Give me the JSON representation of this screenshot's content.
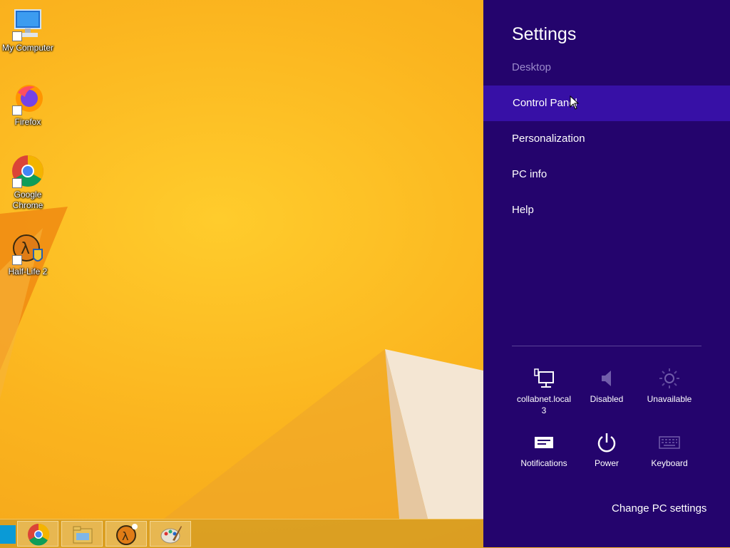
{
  "desktop": {
    "icons": [
      {
        "label": "My Computer",
        "icon": "computer-icon"
      },
      {
        "label": "Firefox",
        "icon": "firefox-icon"
      },
      {
        "label": "Google Chrome",
        "icon": "chrome-icon"
      },
      {
        "label": "Half-Life 2",
        "icon": "half-life-2-icon"
      }
    ]
  },
  "taskbar": {
    "buttons": [
      {
        "icon": "chrome-icon"
      },
      {
        "icon": "file-explorer-icon"
      },
      {
        "icon": "half-life-2-icon"
      },
      {
        "icon": "paint-icon"
      }
    ]
  },
  "settings": {
    "title": "Settings",
    "context": "Desktop",
    "items": [
      {
        "label": "Control Panel",
        "active": true
      },
      {
        "label": "Personalization",
        "active": false
      },
      {
        "label": "PC info",
        "active": false
      },
      {
        "label": "Help",
        "active": false
      }
    ],
    "quick": [
      {
        "label_line1": "collabnet.local",
        "label_line2": "3",
        "icon": "network-icon"
      },
      {
        "label_line1": "Disabled",
        "icon": "volume-icon"
      },
      {
        "label_line1": "Unavailable",
        "icon": "brightness-icon"
      },
      {
        "label_line1": "Notifications",
        "icon": "notifications-icon"
      },
      {
        "label_line1": "Power",
        "icon": "power-icon"
      },
      {
        "label_line1": "Keyboard",
        "icon": "keyboard-icon"
      }
    ],
    "change_pc_settings": "Change PC settings"
  },
  "colors": {
    "charm_bg": "#24046d",
    "charm_active": "#3710a6",
    "wallpaper": "#f6ae1e"
  }
}
